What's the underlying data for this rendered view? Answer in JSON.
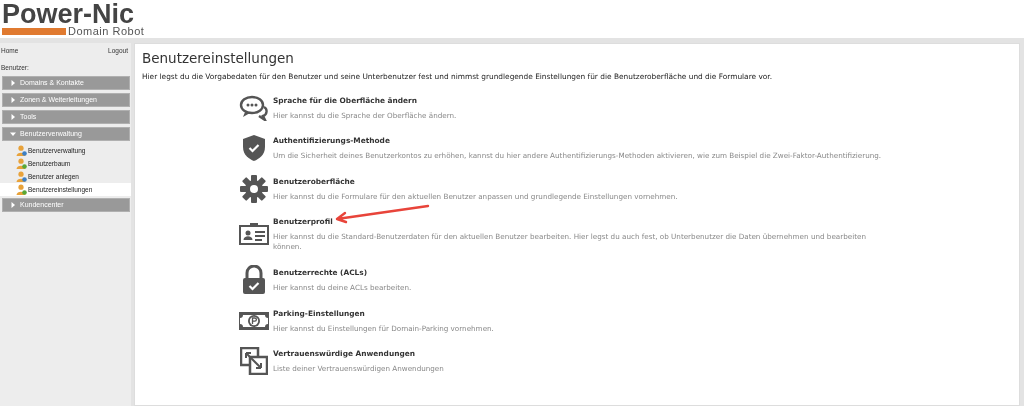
{
  "logo": {
    "name": "Power-Nic",
    "tagline": "Domain Robot"
  },
  "sidebar": {
    "home": "Home",
    "logout": "Logout",
    "user_label": "Benutzer:",
    "groups": [
      {
        "label": "Domains & Kontakte",
        "expanded": false
      },
      {
        "label": "Zonen & Weiterleitungen",
        "expanded": false
      },
      {
        "label": "Tools",
        "expanded": false
      },
      {
        "label": "Benutzerverwaltung",
        "expanded": true,
        "children": [
          {
            "label": "Benutzerverwaltung",
            "selected": false
          },
          {
            "label": "Benutzerbaum",
            "selected": false
          },
          {
            "label": "Benutzer anlegen",
            "selected": false
          },
          {
            "label": "Benutzereinstellungen",
            "selected": true
          }
        ]
      },
      {
        "label": "Kundencenter",
        "expanded": false
      }
    ]
  },
  "main": {
    "title": "Benutzereinstellungen",
    "intro": "Hier legst du die Vorgabedaten für den Benutzer und seine Unterbenutzer fest und nimmst grundlegende Einstellungen für die Benutzeroberfläche und die Formulare vor.",
    "sections": [
      {
        "kind": "chat",
        "title": "Sprache für die Oberfläche ändern",
        "text": "Hier kannst du die Sprache der Oberfläche ändern.",
        "annotated": false
      },
      {
        "kind": "shield",
        "title": "Authentifizierungs-Methode",
        "text": "Um die Sicherheit deines Benutzerkontos zu erhöhen, kannst du hier andere Authentifizierungs-Methoden aktivieren, wie zum Beispiel die Zwei-Faktor-Authentifizierung.",
        "annotated": false
      },
      {
        "kind": "gear",
        "title": "Benutzeroberfläche",
        "text": "Hier kannst du die Formulare für den aktuellen Benutzer anpassen und grundlegende Einstellungen vornehmen.",
        "annotated": false
      },
      {
        "kind": "card",
        "title": "Benutzerprofil",
        "text": "Hier kannst du die Standard-Benutzerdaten für den aktuellen Benutzer bearbeiten. Hier legst du auch fest, ob Unterbenutzer die Daten übernehmen und bearbeiten können.",
        "annotated": true
      },
      {
        "kind": "lock",
        "title": "Benutzerrechte (ACLs)",
        "text": "Hier kannst du deine ACLs bearbeiten.",
        "annotated": false
      },
      {
        "kind": "parking",
        "title": "Parking-Einstellungen",
        "text": "Hier kannst du Einstellungen für Domain-Parking vornehmen.",
        "annotated": false
      },
      {
        "kind": "windows",
        "title": "Vertrauenswürdige Anwendungen",
        "text": "Liste deiner Vertrauenswürdigen Anwendungen",
        "annotated": false
      }
    ]
  }
}
